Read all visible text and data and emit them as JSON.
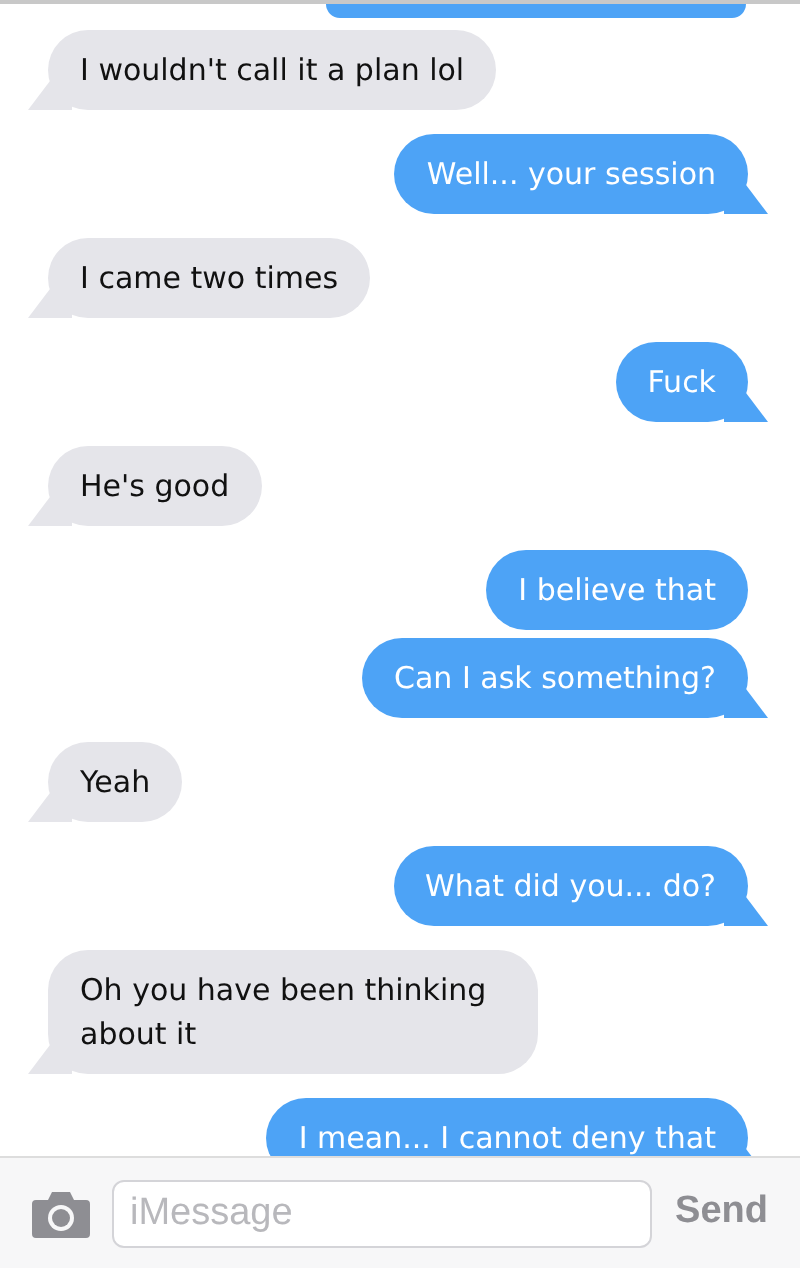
{
  "messages": [
    {
      "kind": "received",
      "text": "I wouldn't call it a plan lol"
    },
    {
      "kind": "sent",
      "text": "Well... your session"
    },
    {
      "kind": "received",
      "text": "I came two times"
    },
    {
      "kind": "sent",
      "text": "Fuck"
    },
    {
      "kind": "received",
      "text": "He's good"
    },
    {
      "kind": "sent",
      "text": "I believe that"
    },
    {
      "kind": "sent",
      "text": "Can I ask something?"
    },
    {
      "kind": "received",
      "text": "Yeah"
    },
    {
      "kind": "sent",
      "text": "What did you... do?"
    },
    {
      "kind": "received",
      "text": "Oh you have been thinking about it"
    },
    {
      "kind": "sent",
      "text": "I mean... I cannot deny that"
    }
  ],
  "composer": {
    "placeholder": "iMessage",
    "send": "Send"
  }
}
